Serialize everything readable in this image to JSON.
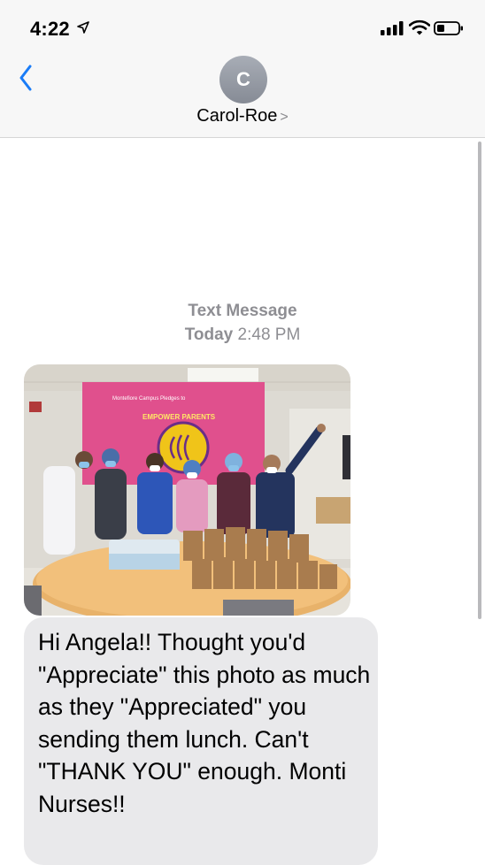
{
  "status_bar": {
    "time": "4:22",
    "location_icon": "location-arrow-icon",
    "signal_icon": "cellular-signal-icon",
    "wifi_icon": "wifi-icon",
    "battery_icon": "battery-icon"
  },
  "header": {
    "back_icon": "chevron-left-icon",
    "avatar_initial": "C",
    "contact_name": "Carol-Roe",
    "contact_chevron": ">"
  },
  "conversation": {
    "timestamp_type": "Text Message",
    "timestamp_day": "Today",
    "timestamp_time": "2:48 PM",
    "photo": {
      "banner_text": "EMPOWER PARENTS"
    },
    "message_text": "Hi Angela!! Thought you'd \"Appreciate\" this photo as much as they \"Appreciated\" you sending them lunch. Can't \"THANK YOU\" enough. Monti Nurses!!"
  },
  "colors": {
    "accent": "#1a7cf7",
    "header_bg": "#f7f7f7",
    "bubble_bg": "#e9e9eb",
    "timestamp": "#8e8e93"
  }
}
